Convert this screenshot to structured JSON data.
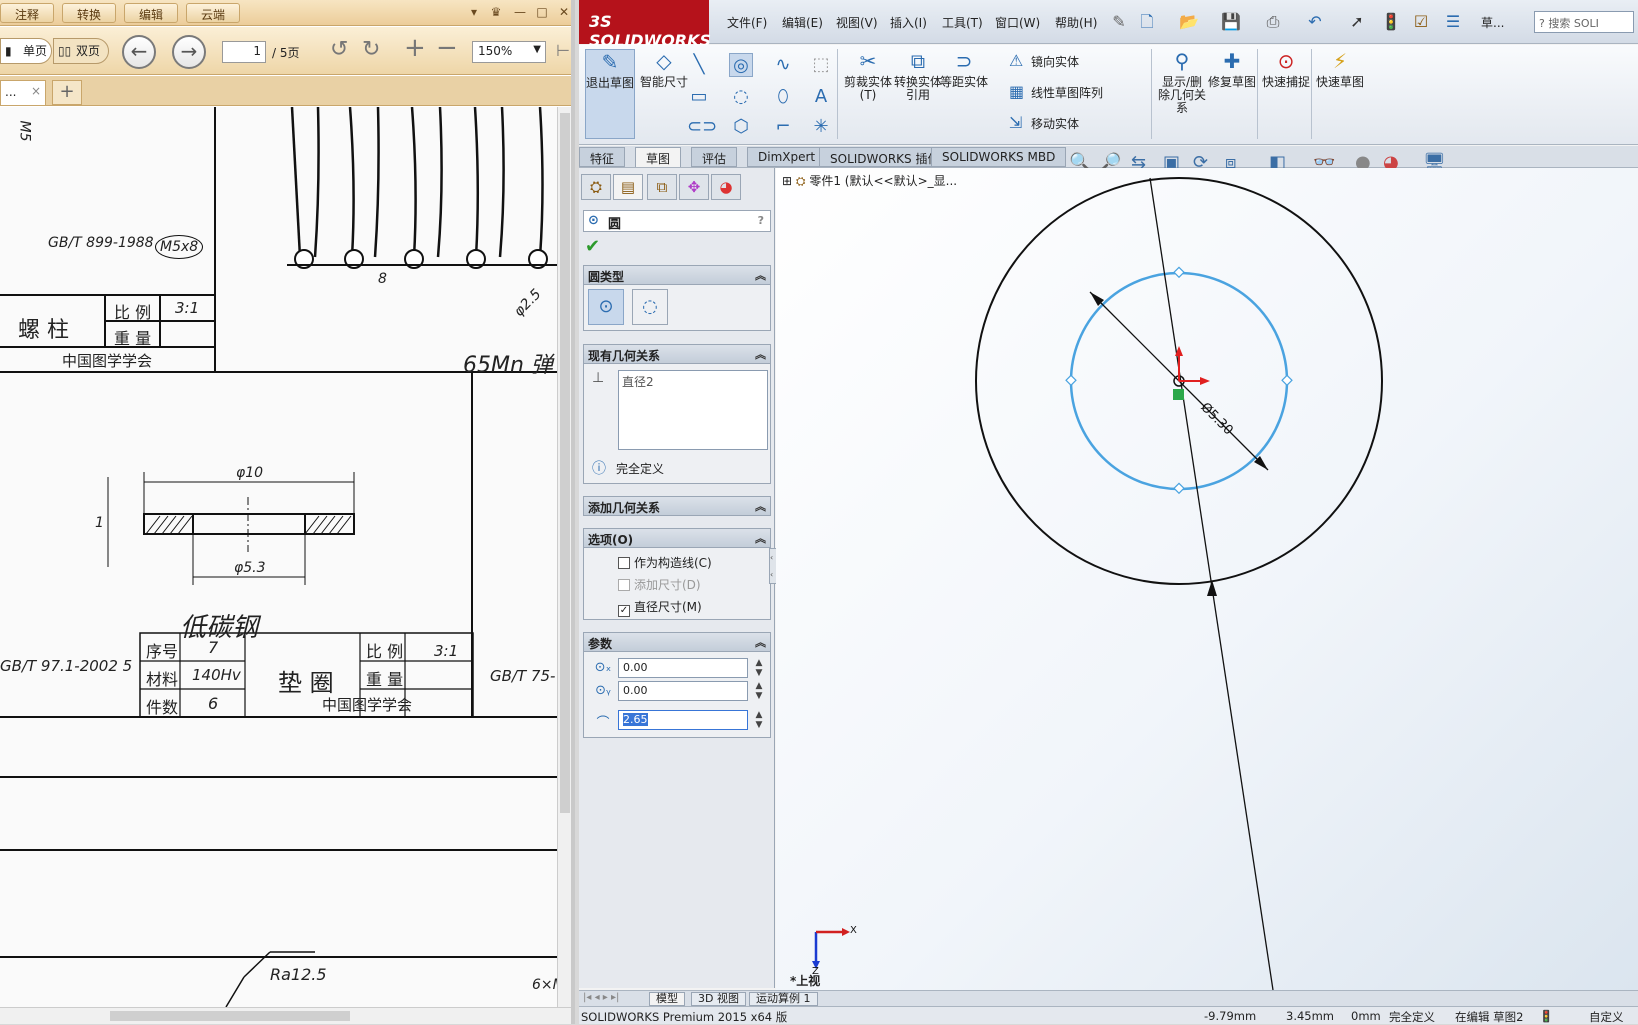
{
  "pdf": {
    "menu": [
      "注释",
      "转换",
      "编辑",
      "云端"
    ],
    "view_single": "单页",
    "view_double": "双页",
    "page_current": "1",
    "page_total": "/ 5页",
    "zoom": "150%",
    "tab_label": "...",
    "tab_close": "×",
    "tab_add": "+"
  },
  "drawing": {
    "standard_screw": "GB/T 899-1988",
    "screw_spec": "M5x8",
    "m5": "M5",
    "pillar_title": "螺 柱",
    "ratio_label": "比 例",
    "weight_label": "重 量",
    "scale_31": "3:1",
    "society": "中国图学学会",
    "steel": "65Mn 弹",
    "dim_8": "8",
    "dim_phi25": "φ2.5",
    "dim_phi10": "φ10",
    "dim_phi53": "φ5.3",
    "dim_1": "1",
    "handwrite_steel": "低碳钢",
    "washer_std": "GB/T 97.1-2002 5",
    "seq_label": "序号",
    "seq_value": "7",
    "material_label": "材料",
    "material_value": "140Hv",
    "count_label": "件数",
    "count_value": "6",
    "washer_title": "垫 圈",
    "std_right": "GB/T 75-",
    "ra": "Ra12.5",
    "six_m": "6×M"
  },
  "sw": {
    "logo": "3S SOLIDWORKS",
    "menus": [
      "文件(F)",
      "编辑(E)",
      "视图(V)",
      "插入(I)",
      "工具(T)",
      "窗口(W)",
      "帮助(H)"
    ],
    "search_placeholder": "搜索 SOLI",
    "user_menu": "草...",
    "cmd": {
      "exit_sketch": "退出草图",
      "smart_dim": "智能尺寸",
      "trim": "剪裁实体(T)",
      "convert": "转换实体引用",
      "offset": "等距实体",
      "mirror": "镜向实体",
      "linear_pattern": "线性草图阵列",
      "move": "移动实体",
      "show_delete": "显示/删除几何关系",
      "repair": "修复草图",
      "quick_snap": "快速捕捉",
      "rapid_sketch": "快速草图"
    },
    "tabs": [
      "特征",
      "草图",
      "评估",
      "DimXpert",
      "SOLIDWORKS 插件",
      "SOLIDWORKS MBD"
    ],
    "tree_item": "零件1 (默认<<默认>_显...",
    "pm": {
      "title": "圆",
      "help": "?",
      "group_type": "圆类型",
      "group_existing": "现有几何关系",
      "relation": "直径2",
      "status": "完全定义",
      "group_add": "添加几何关系",
      "group_options": "选项(O)",
      "opt_construction": "作为构造线(C)",
      "opt_add_dim": "添加尺寸(D)",
      "opt_diameter": "直径尺寸(M)",
      "group_params": "参数",
      "cx": "0.00",
      "cy": "0.00",
      "radius": "2.65"
    },
    "dimension_label": "Ø5.30",
    "view_name": "*上视",
    "axis_x": "X",
    "axis_z": "Z",
    "bottom_tabs": [
      "模型",
      "3D 视图",
      "运动算例 1"
    ],
    "status": {
      "product": "SOLIDWORKS Premium 2015 x64 版",
      "x": "-9.79mm",
      "y": "3.45mm",
      "z": "0mm",
      "defined": "完全定义",
      "editing": "在编辑 草图2",
      "custom": "自定义"
    }
  }
}
